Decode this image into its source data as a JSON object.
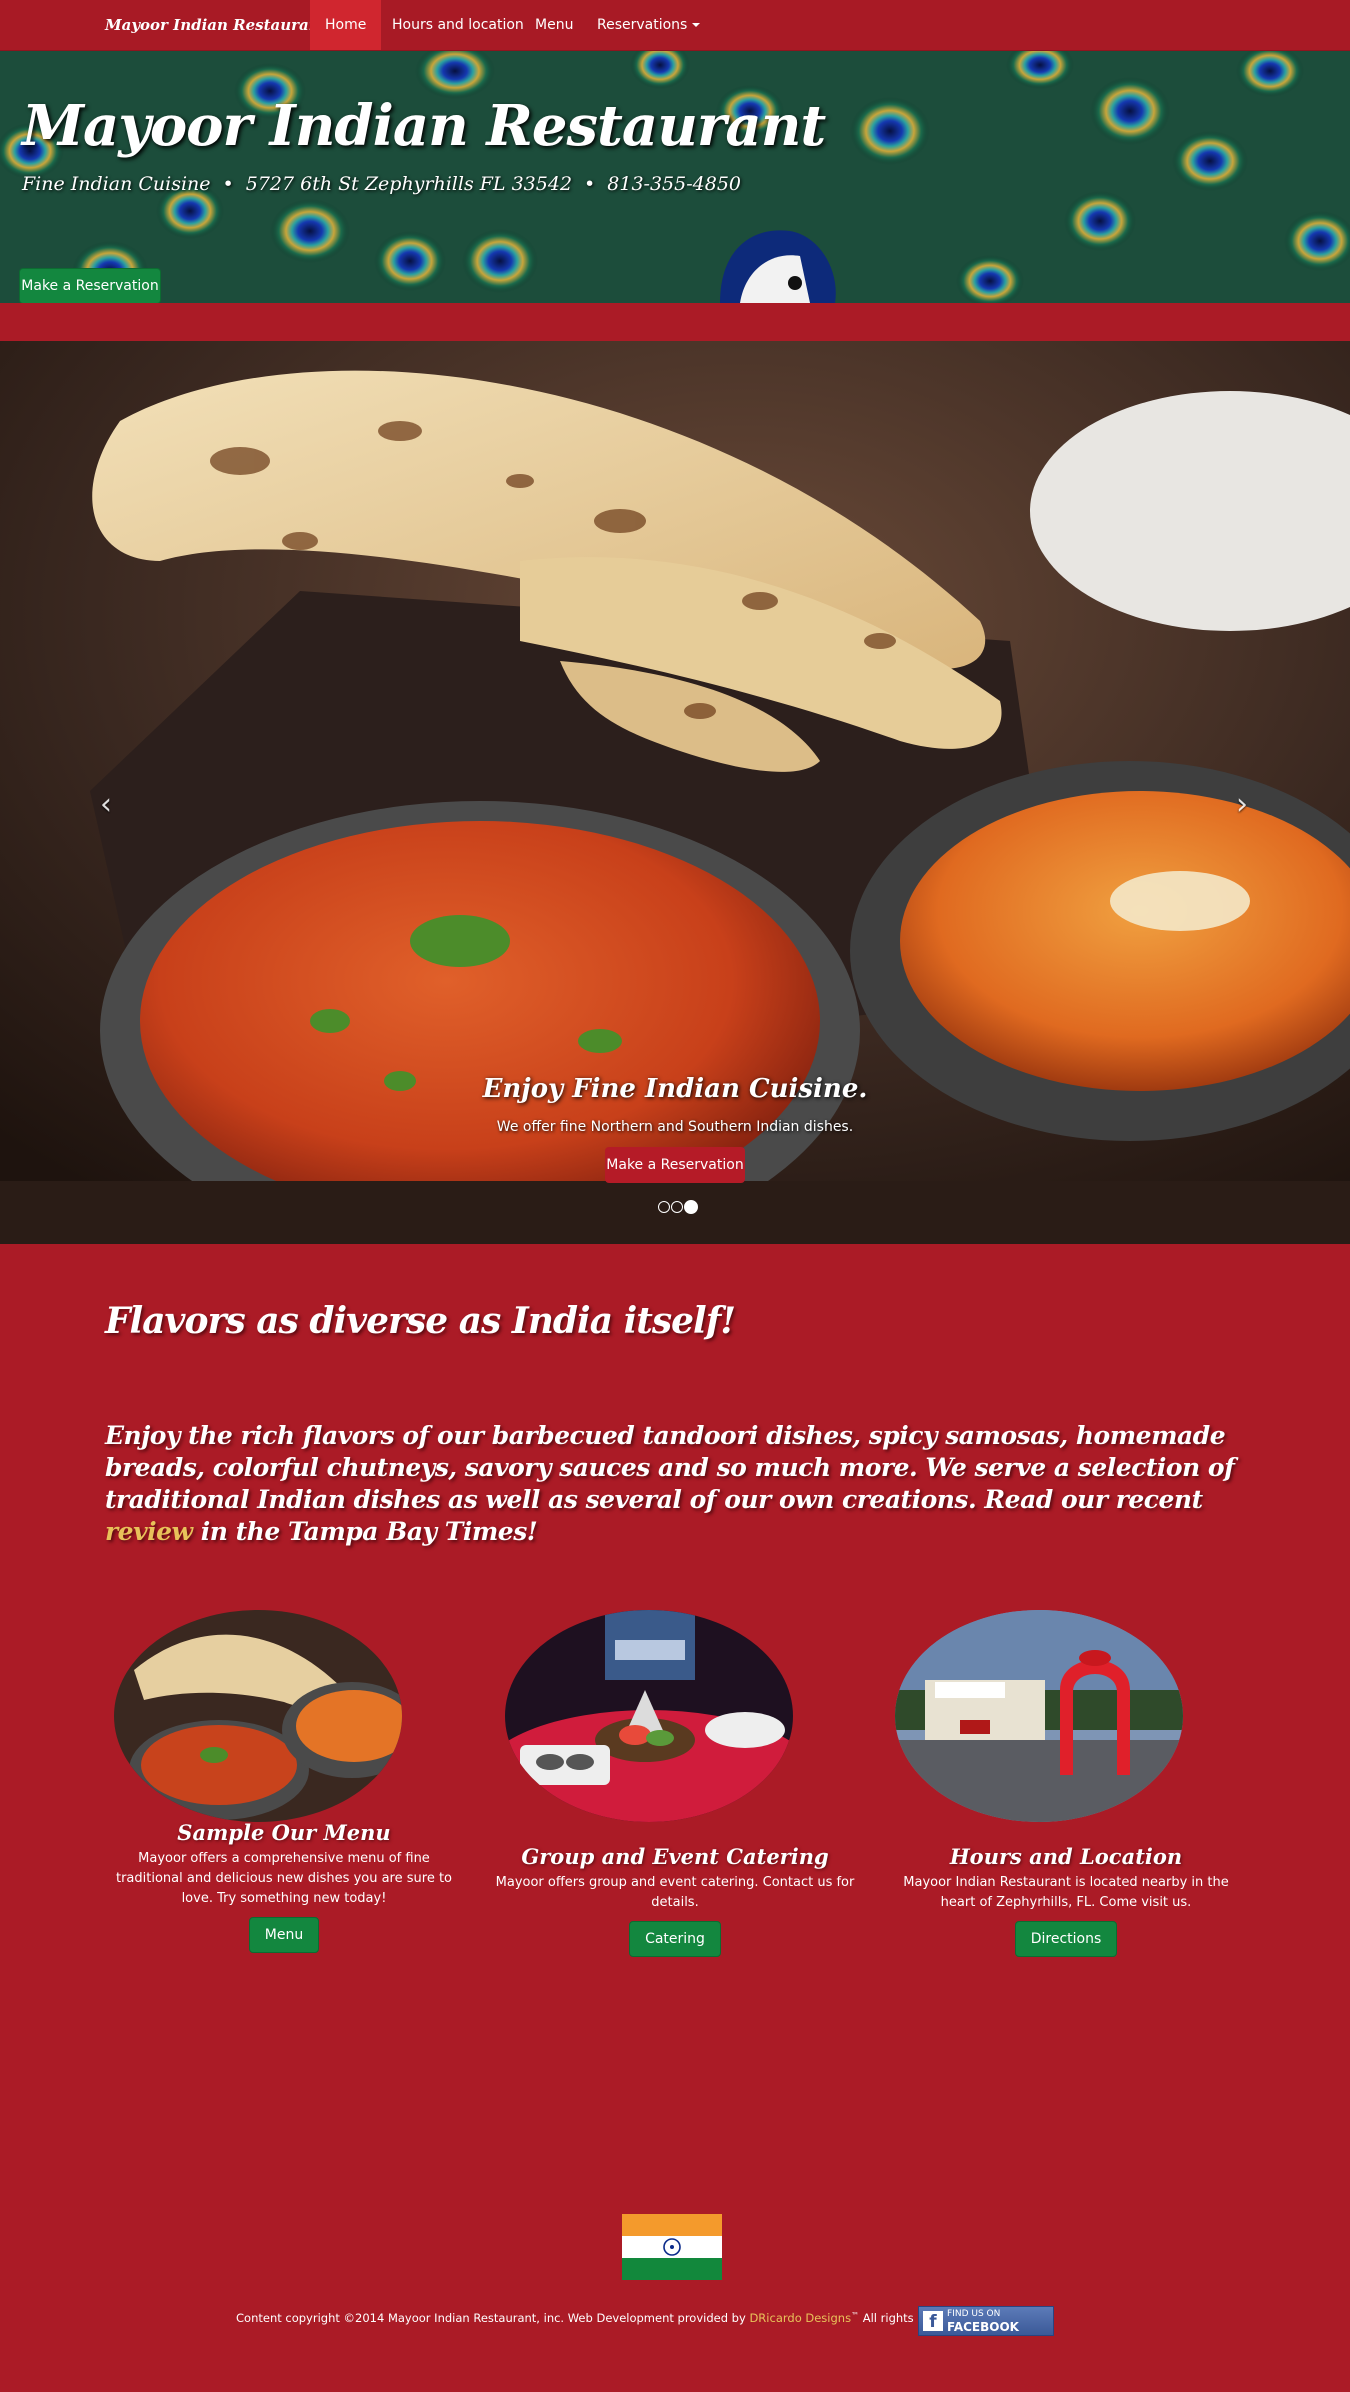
{
  "navbar": {
    "brand": "Mayoor Indian Restaurant",
    "items": [
      {
        "label": "Home",
        "active": true
      },
      {
        "label": "Hours and location"
      },
      {
        "label": "Menu"
      },
      {
        "label": "Reservations"
      }
    ]
  },
  "hero": {
    "title": "Mayoor Indian Restaurant",
    "subtitle_parts": [
      "Fine Indian Cuisine",
      "5727 6th St Zephyrhills FL 33542",
      "813-355-4850"
    ],
    "separator": "•",
    "button_label": "Make a Reservation"
  },
  "carousel": {
    "prev_icon": "chevron-left-icon",
    "next_icon": "chevron-right-icon",
    "caption_title": "Enjoy Fine Indian Cuisine.",
    "caption_text": "We offer fine Northern and Southern Indian dishes.",
    "button_label": "Make a Reservation",
    "slide_count": 3,
    "active_slide": 3
  },
  "content": {
    "headline": "Flavors as diverse as India itself!",
    "intro_before": "Enjoy the rich flavors of our barbecued tandoori dishes, spicy samosas, homemade breads, colorful chutneys, savory sauces and so much more. We serve a selection of traditional Indian dishes as well as several of our own creations. Read our recent ",
    "intro_link": "review",
    "intro_after": " in the Tampa Bay Times!"
  },
  "features": [
    {
      "title": "Sample Our Menu",
      "text": "Mayoor offers a comprehensive menu of fine traditional and delicious new dishes you are sure to love. Try something new today!",
      "button": "Menu"
    },
    {
      "title": "Group and Event Catering",
      "text": "Mayoor offers group and event catering. Contact us for details.",
      "button": "Catering"
    },
    {
      "title": "Hours and Location",
      "text": "Mayoor Indian Restaurant is located nearby in the heart of Zephyrhills, FL. Come visit us.",
      "button": "Directions"
    }
  ],
  "footer": {
    "copyright_before": "Content copyright ©2014 Mayoor Indian Restaurant, inc. Web Development provided by ",
    "designer_link": "DRicardo Designs",
    "trademark": "™",
    "copyright_after": " All rights reserved.",
    "facebook_line1": "FIND US ON",
    "facebook_line2": "FACEBOOK"
  },
  "colors": {
    "background": "#ab1b26",
    "navbar": "#a81a25",
    "active_nav": "#d0262f",
    "button_green": "#13873f",
    "link_gold": "#e8c25a"
  }
}
